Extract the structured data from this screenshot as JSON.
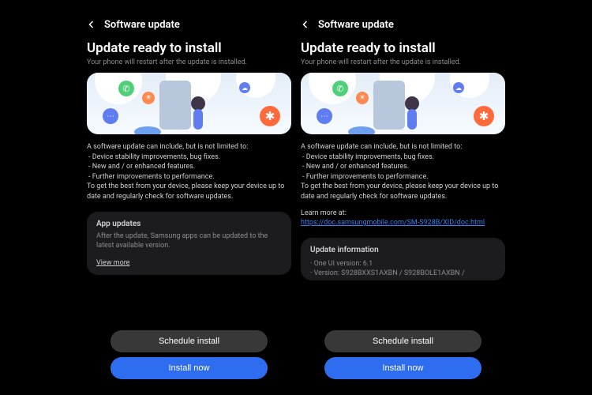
{
  "left": {
    "header": "Software update",
    "title": "Update ready to install",
    "subtitle": "Your phone will restart after the update is installed.",
    "desc_intro": "A software update can include, but is not limited to:",
    "desc_items": [
      "Device stability improvements, bug fixes.",
      "New and / or enhanced features.",
      "Further improvements to performance."
    ],
    "desc_out": "To get the best from your device, please keep your device up to date and regularly check for software updates.",
    "card_title": "App updates",
    "card_body": "After the update, Samsung apps can be updated to the latest available version.",
    "card_link": "View more",
    "btn_schedule": "Schedule install",
    "btn_install": "Install now"
  },
  "right": {
    "header": "Software update",
    "title": "Update ready to install",
    "subtitle": "Your phone will restart after the update is installed.",
    "desc_intro": "A software update can include, but is not limited to:",
    "desc_items": [
      "Device stability improvements, bug fixes.",
      "New and / or enhanced features.",
      "Further improvements to performance."
    ],
    "desc_out": "To get the best from your device, please keep your device up to date and regularly check for software updates.",
    "learn_label": "Learn more at:",
    "learn_url": "https://doc.samsungmobile.com/SM-S928B/XID/doc.html",
    "info_title": "Update information",
    "info_items": [
      "One UI version: 6.1",
      "Version: S928BXXS1AXBN / S928BOLE1AXBN /"
    ],
    "btn_schedule": "Schedule install",
    "btn_install": "Install now"
  }
}
